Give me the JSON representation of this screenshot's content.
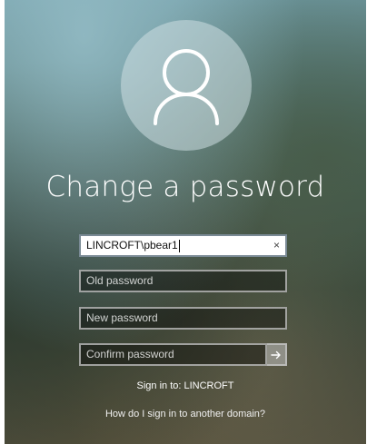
{
  "title": "Change a password",
  "username": {
    "value": "LINCROFT\\pbear1",
    "clear_glyph": "×"
  },
  "old_password": {
    "placeholder": "Old password"
  },
  "new_password": {
    "placeholder": "New password"
  },
  "confirm_password": {
    "placeholder": "Confirm password"
  },
  "sign_in_to": "Sign in to: LINCROFT",
  "other_domain_link": "How do I sign in to another domain?",
  "icons": {
    "avatar": "user-icon",
    "clear": "clear-icon",
    "submit": "arrow-right-icon"
  }
}
